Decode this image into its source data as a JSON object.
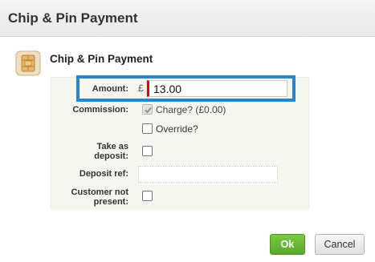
{
  "dialog": {
    "title": "Chip & Pin Payment",
    "heading": "Chip & Pin Payment"
  },
  "form": {
    "amount_label": "Amount:",
    "currency_symbol": "£",
    "amount_value": "13.00",
    "commission_label": "Commission:",
    "charge_label": "Charge? (£0.00)",
    "charge_checked": true,
    "charge_disabled": true,
    "override_label": "Override?",
    "override_checked": false,
    "deposit_label_line1": "Take as",
    "deposit_label_line2": "deposit:",
    "deposit_checked": false,
    "deposit_ref_label": "Deposit ref:",
    "deposit_ref_value": "",
    "cnp_label_line1": "Customer not",
    "cnp_label_line2": "present:",
    "cnp_checked": false
  },
  "buttons": {
    "ok_label": "Ok",
    "cancel_label": "Cancel"
  },
  "colors": {
    "highlight": "#2a86c8",
    "ok_button": "#6bba36",
    "invalid_marker": "#d10b0b"
  },
  "icons": {
    "chip": "chip-card-icon"
  }
}
